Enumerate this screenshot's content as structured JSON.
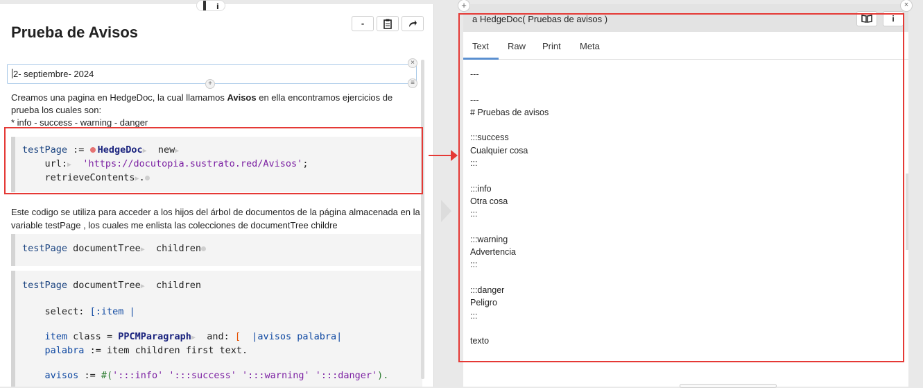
{
  "left_pane": {
    "title": "Prueba de Avisos",
    "toolbar": {
      "minimize_label": "-",
      "clipboard_icon": "clipboard-icon",
      "share_icon": "share-arrow-icon"
    },
    "date_field_value": "2- septiembre- 2024",
    "intro": {
      "line1_pre": "Creamos una pagina en HedgeDoc, la cual llamamos ",
      "line1_bold": "Avisos",
      "line1_post": " en ella encontramos ejercicios de prueba los cuales son:",
      "line2": " * info - success - warning - danger"
    },
    "code1": {
      "var": "testPage",
      "assign": ":=",
      "cls": "HedgeDoc",
      "msg_new": "new",
      "url_kw": "url:",
      "url_str": "'https://docutopia.sustrato.red/Avisos'",
      "url_end": ";",
      "retrieve": "retrieveContents",
      "period": "."
    },
    "description": "Este codigo se utiliza para acceder a los hijos del árbol de documentos de la página almacenada en la variable testPage , los cuales me enlista las colecciones de  documentTree childre",
    "code2": {
      "var": "testPage",
      "msg1": "documentTree",
      "msg2": "children"
    },
    "code3": {
      "var": "testPage",
      "msg1": "documentTree",
      "msg2": "children",
      "select_kw": "select:",
      "block_open": "[:item |",
      "item_var": "item",
      "class_msg": "class",
      "eq": "=",
      "cls": "PPCMParagraph",
      "and_kw": "and:",
      "block2": "[",
      "block_args": "|avisos palabra|",
      "palabra_var": "palabra",
      "palabra_expr": ":= item children first text.",
      "avisos_var": "avisos",
      "avisos_assign": ":=",
      "avisos_array_open": "#(",
      "avisos_items": "':::info' ':::success' ':::warning' ':::danger'",
      "avisos_array_close": ")."
    }
  },
  "right_pane": {
    "inspector_title": "a HedgeDoc( Pruebas de avisos )",
    "buttons": {
      "book_icon": "book-icon",
      "info_label": "i"
    },
    "tabs": [
      "Text",
      "Raw",
      "Print",
      "Meta"
    ],
    "active_tab": "Text",
    "text_content": "---\n\n---\n# Pruebas de avisos\n\n:::success\nCualquier cosa\n:::\n\n:::info\nOtra cosa\n:::\n\n:::warning\nAdvertencia\n:::\n\n:::danger\nPeligro\n:::\n\ntexto"
  },
  "chrome": {
    "info_badge": "i",
    "close_label": "×",
    "plus_label": "+"
  },
  "colors": {
    "highlight": "#e53935",
    "active_tab": "#5a8fd0"
  }
}
